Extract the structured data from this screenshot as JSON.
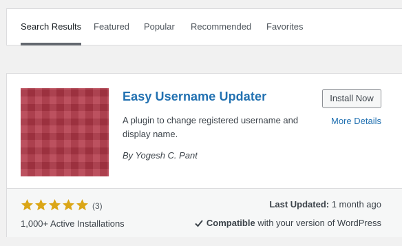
{
  "tabs": [
    {
      "label": "Search Results",
      "active": true
    },
    {
      "label": "Featured",
      "active": false
    },
    {
      "label": "Popular",
      "active": false
    },
    {
      "label": "Recommended",
      "active": false
    },
    {
      "label": "Favorites",
      "active": false
    }
  ],
  "plugin": {
    "name": "Easy Username Updater",
    "description": "A plugin to change registered username and display name.",
    "author": "By Yogesh C. Pant",
    "install_label": "Install Now",
    "more_details_label": "More Details",
    "thumbnail_icon": "pixelated-red-banner",
    "rating": {
      "stars": 5,
      "max_stars": 5,
      "count_label": "(3)"
    },
    "active_installs": "1,000+ Active Installations",
    "last_updated_label": "Last Updated:",
    "last_updated_value": "1 month ago",
    "compatible_strong": "Compatible",
    "compatible_rest": "with your version of WordPress"
  },
  "colors": {
    "link": "#2271b1",
    "star": "#dba617",
    "active_tab_underline": "#646970"
  }
}
